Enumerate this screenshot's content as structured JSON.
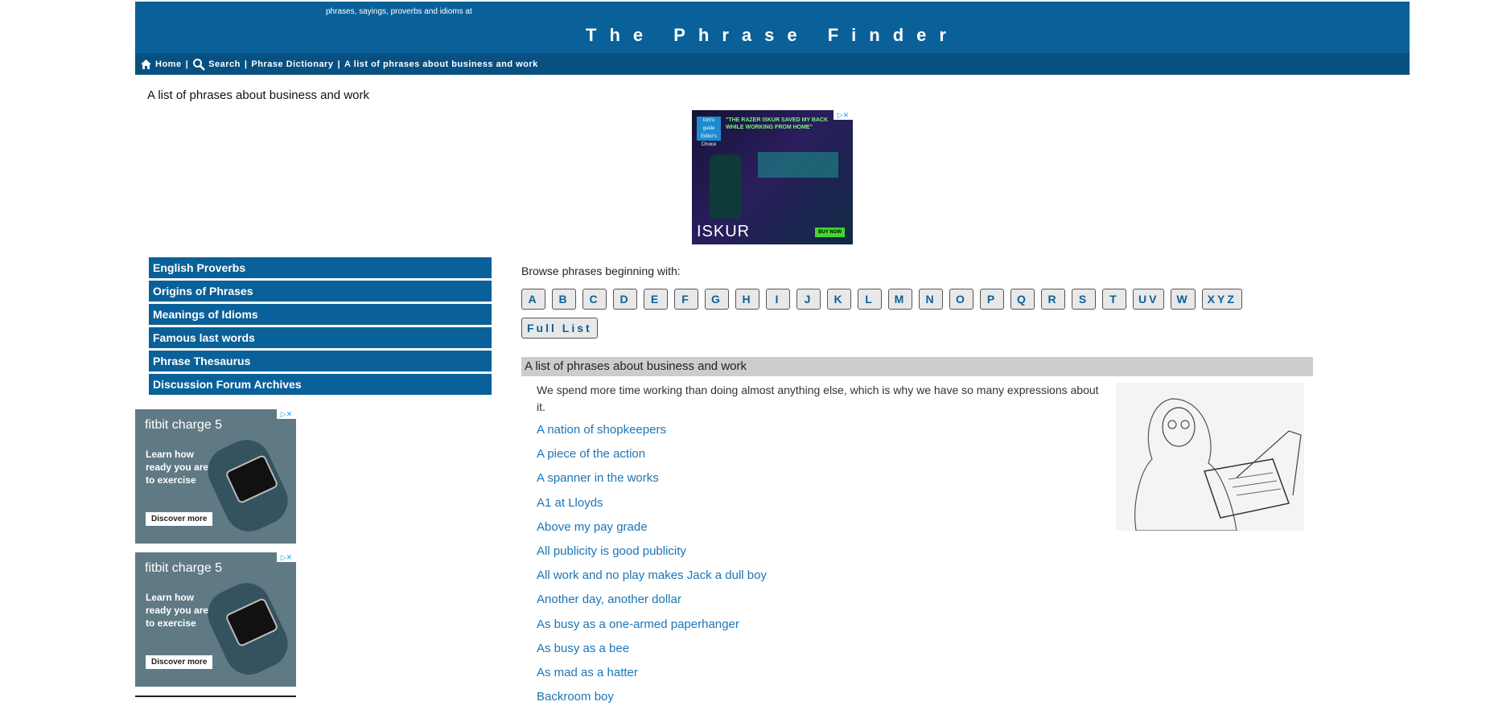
{
  "header": {
    "tagline": "phrases, sayings, proverbs and idioms at",
    "title": "The Phrase Finder",
    "colors": {
      "header_bg": "#0a6199",
      "nav_bg": "#075081"
    }
  },
  "breadcrumb": {
    "home": "Home",
    "search": "Search",
    "dictionary": "Phrase Dictionary",
    "current": "A list of phrases about business and work",
    "separator": "|"
  },
  "page_heading": "A list of phrases about business and work",
  "ads": {
    "top": {
      "quote": "\"THE RAZER ISKUR SAVED MY BACK WHILE WORKING FROM HOME\"",
      "logo": "tom's guide Editor's Choice",
      "brand": "ISKUR",
      "sub_brand": "RAZER",
      "cta": "BUY NOW"
    },
    "side": {
      "brand": "fitbit charge 5",
      "copy": "Learn how ready you are to exercise",
      "cta": "Discover more"
    }
  },
  "sidebar": {
    "items": [
      {
        "label": "English Proverbs"
      },
      {
        "label": "Origins of Phrases"
      },
      {
        "label": "Meanings of Idioms"
      },
      {
        "label": "Famous last words"
      },
      {
        "label": "Phrase Thesaurus"
      },
      {
        "label": "Discussion Forum Archives"
      }
    ]
  },
  "browse": {
    "label": "Browse phrases beginning with:",
    "letters": [
      "A",
      "B",
      "C",
      "D",
      "E",
      "F",
      "G",
      "H",
      "I",
      "J",
      "K",
      "L",
      "M",
      "N",
      "O",
      "P",
      "Q",
      "R",
      "S",
      "T",
      "UV",
      "W",
      "XYZ",
      "Full List"
    ]
  },
  "section": {
    "title": "A list of phrases about business and work",
    "intro": "We spend more time working than doing almost anything else, which is why we have so many expressions about it.",
    "phrases": [
      "A nation of shopkeepers",
      "A piece of the action",
      "A spanner in the works",
      "A1 at Lloyds",
      "Above my pay grade",
      "All publicity is good publicity",
      "All work and no play makes Jack a dull boy",
      "Another day, another dollar",
      "As busy as a one-armed paperhanger",
      "As busy as a bee",
      "As mad as a hatter",
      "Backroom boy"
    ]
  }
}
